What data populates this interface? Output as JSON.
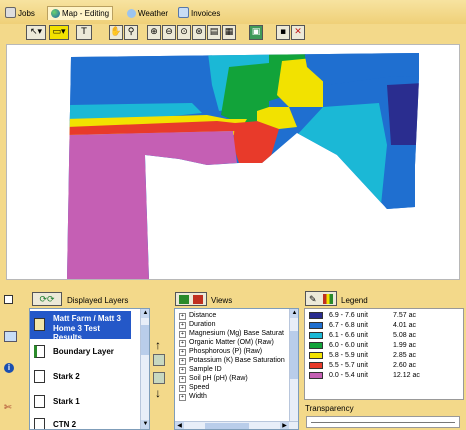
{
  "tabs": [
    {
      "label": "Jobs",
      "icon": "jobs-icon"
    },
    {
      "label": "Map - Editing",
      "icon": "globe-icon"
    },
    {
      "label": "Weather",
      "icon": "weather-icon"
    },
    {
      "label": "Invoices",
      "icon": "invoices-icon"
    }
  ],
  "toolbar": {
    "buttons": [
      "pointer-tool",
      "layer-color-tool",
      "text-tool",
      "pan-tool",
      "magnify-tool",
      "zoom-in",
      "zoom-out",
      "zoom-extent",
      "zoom-previous",
      "print-preview",
      "map-export",
      "save",
      "delete"
    ]
  },
  "layers_panel": {
    "header": "Displayed Layers",
    "items": [
      {
        "label_line1": "Matt Farm / Matt 3",
        "label_line2": "Home 3 Test Results",
        "selected": true
      },
      {
        "label_line1": "Boundary Layer"
      },
      {
        "label_line1": "Stark 2"
      },
      {
        "label_line1": "Stark 1"
      },
      {
        "label_line1": "CTN 2"
      }
    ]
  },
  "views_panel": {
    "header": "Views",
    "items": [
      "Distance",
      "Duration",
      "Magnesium (Mg) Base Saturat",
      "Organic Matter (OM) (Raw)",
      "Phosphorous (P) (Raw)",
      "Potassium (K) Base Saturation",
      "Sample ID",
      "Soil pH (pH) (Raw)",
      "Speed",
      "Width"
    ],
    "selected_index": 7
  },
  "legend_panel": {
    "header": "Legend",
    "rows": [
      {
        "range": "6.9 - 7.6 unit",
        "area": "7.57 ac",
        "color": "#2a2d8f"
      },
      {
        "range": "6.7 - 6.8 unit",
        "area": "4.01 ac",
        "color": "#1f6fd0"
      },
      {
        "range": "6.1 - 6.6 unit",
        "area": "5.08 ac",
        "color": "#1bb8d6"
      },
      {
        "range": "6.0 - 6.0 unit",
        "area": "1.99 ac",
        "color": "#12a33a"
      },
      {
        "range": "5.8 - 5.9 unit",
        "area": "2.85 ac",
        "color": "#f2e200"
      },
      {
        "range": "5.5 - 5.7 unit",
        "area": "2.60 ac",
        "color": "#e83a2a"
      },
      {
        "range": "0.0 - 5.4 unit",
        "area": "12.12 ac",
        "color": "#c55fb4"
      }
    ],
    "transparency_label": "Transparency"
  }
}
